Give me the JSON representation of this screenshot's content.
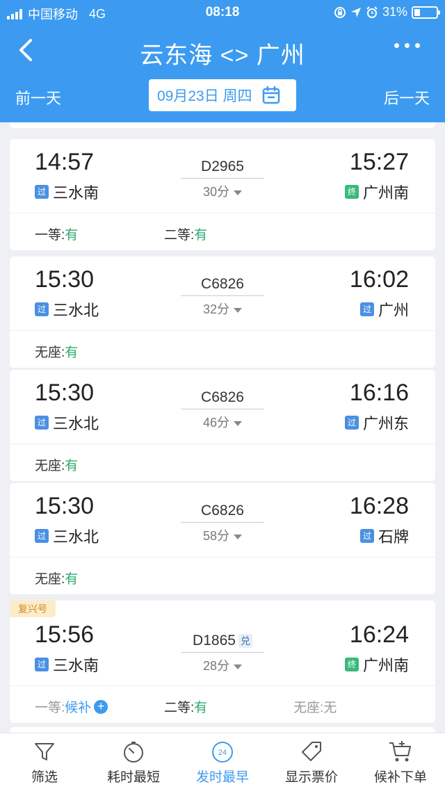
{
  "status_bar": {
    "carrier": "中国移动",
    "network": "4G",
    "time": "08:18",
    "battery": "31%"
  },
  "nav": {
    "title": "云东海 <> 广州"
  },
  "date_bar": {
    "prev_label": "前一天",
    "date": "09月23日 周四",
    "next_label": "后一天"
  },
  "trains": [
    {
      "depart_time": "14:57",
      "depart_station": "三水南",
      "depart_tag": "过",
      "train_no": "D2965",
      "duration": "30分",
      "arrive_time": "15:27",
      "arrive_station": "广州南",
      "arrive_tag": "终",
      "seats": [
        {
          "label": "一等:",
          "value": "有"
        },
        {
          "label": "二等:",
          "value": "有"
        }
      ]
    },
    {
      "depart_time": "15:30",
      "depart_station": "三水北",
      "depart_tag": "过",
      "train_no": "C6826",
      "duration": "32分",
      "arrive_time": "16:02",
      "arrive_station": "广州",
      "arrive_tag": "过",
      "seats": [
        {
          "label": "无座:",
          "value": "有"
        }
      ]
    },
    {
      "depart_time": "15:30",
      "depart_station": "三水北",
      "depart_tag": "过",
      "train_no": "C6826",
      "duration": "46分",
      "arrive_time": "16:16",
      "arrive_station": "广州东",
      "arrive_tag": "过",
      "seats": [
        {
          "label": "无座:",
          "value": "有"
        }
      ]
    },
    {
      "depart_time": "15:30",
      "depart_station": "三水北",
      "depart_tag": "过",
      "train_no": "C6826",
      "duration": "58分",
      "arrive_time": "16:28",
      "arrive_station": "石牌",
      "arrive_tag": "过",
      "seats": [
        {
          "label": "无座:",
          "value": "有"
        }
      ]
    },
    {
      "badge": "复兴号",
      "depart_time": "15:56",
      "depart_station": "三水南",
      "depart_tag": "过",
      "train_no": "D1865",
      "train_badge": "兑",
      "duration": "28分",
      "arrive_time": "16:24",
      "arrive_station": "广州南",
      "arrive_tag": "终",
      "seats": [
        {
          "label": "一等:",
          "value": "候补"
        },
        {
          "label": "二等:",
          "value": "有"
        },
        {
          "label": "无座:",
          "value": "无"
        }
      ]
    }
  ],
  "tabs": [
    {
      "label": "筛选",
      "icon": "filter-icon"
    },
    {
      "label": "耗时最短",
      "icon": "stopwatch-icon"
    },
    {
      "label": "发时最早",
      "icon": "clock-24-icon",
      "icon_text": "24",
      "active": true
    },
    {
      "label": "显示票价",
      "icon": "price-tag-icon"
    },
    {
      "label": "候补下单",
      "icon": "cart-plus-icon"
    }
  ],
  "colors": {
    "primary": "#3c9bf0",
    "available": "#2eaa6e",
    "pass_tag": "#4a90e2",
    "terminal_tag": "#3ab97a",
    "badge_bg": "#fdecc8",
    "badge_text": "#d08a2c"
  }
}
